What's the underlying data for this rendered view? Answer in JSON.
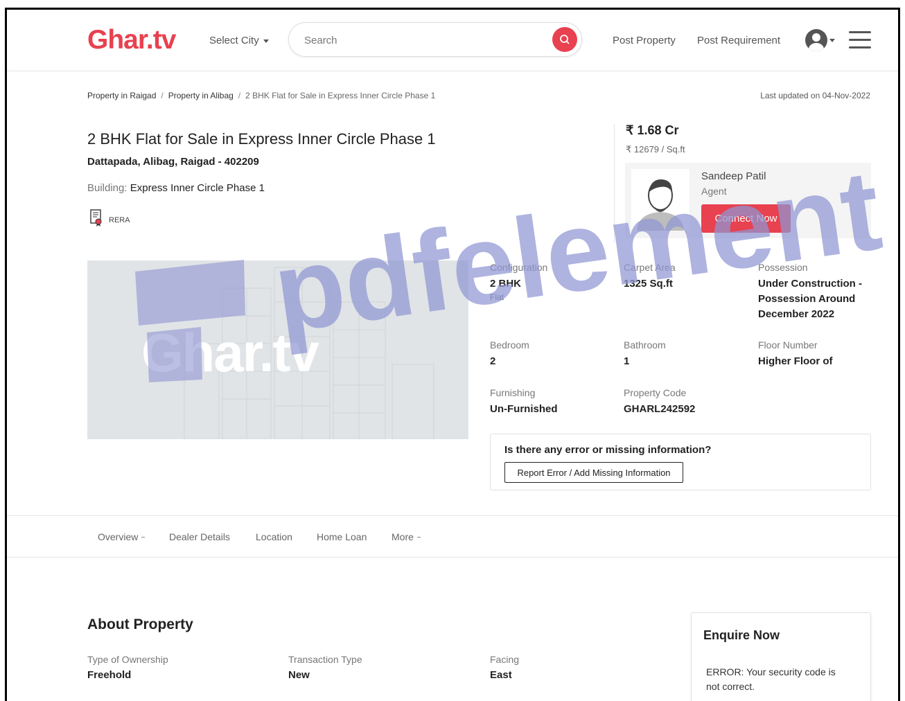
{
  "header": {
    "logo": "Ghar.tv",
    "select_city": "Select City",
    "search_placeholder": "Search",
    "post_property": "Post Property",
    "post_requirement": "Post Requirement"
  },
  "breadcrumb": {
    "items": [
      "Property in Raigad",
      "Property in Alibag"
    ],
    "current": "2 BHK Flat for Sale in Express Inner Circle Phase 1"
  },
  "last_updated": "Last updated on 04-Nov-2022",
  "property": {
    "title": "2 BHK Flat for Sale in Express Inner Circle Phase 1",
    "address": "Dattapada, Alibag, Raigad - 402209",
    "building_label": "Building:",
    "building_name": "Express Inner Circle Phase 1",
    "rera": "RERA",
    "image_logo": "Ghar.tv",
    "price": "₹ 1.68 Cr",
    "price_per_sqft": "₹ 12679 / Sq.ft"
  },
  "agent": {
    "name": "Sandeep Patil",
    "role": "Agent",
    "connect_label": "Connect Now"
  },
  "specs": {
    "configuration": {
      "label": "Configuration",
      "value": "2 BHK",
      "sub": "Flat"
    },
    "carpet_area": {
      "label": "Carpet Area",
      "value": "1325 Sq.ft"
    },
    "possession": {
      "label": "Possession",
      "value": "Under Construction - Possession Around December 2022"
    },
    "bedroom": {
      "label": "Bedroom",
      "value": "2"
    },
    "bathroom": {
      "label": "Bathroom",
      "value": "1"
    },
    "floor_number": {
      "label": "Floor Number",
      "value": "Higher Floor of"
    },
    "furnishing": {
      "label": "Furnishing",
      "value": "Un-Furnished"
    },
    "property_code": {
      "label": "Property Code",
      "value": "GHARL242592"
    }
  },
  "error_box": {
    "question": "Is there any error or missing information?",
    "button": "Report Error / Add Missing Information"
  },
  "tabs": [
    "Overview",
    "Dealer Details",
    "Location",
    "Home Loan",
    "More"
  ],
  "about": {
    "title": "About Property",
    "items": [
      {
        "label": "Type of Ownership",
        "value": "Freehold"
      },
      {
        "label": "Transaction Type",
        "value": "New"
      },
      {
        "label": "Facing",
        "value": "East"
      }
    ]
  },
  "enquire": {
    "title": "Enquire Now",
    "error": "ERROR: Your security code is not correct."
  },
  "watermark": "pdfelement",
  "colors": {
    "brand": "#e8414f",
    "watermark": "#8f95d2"
  }
}
